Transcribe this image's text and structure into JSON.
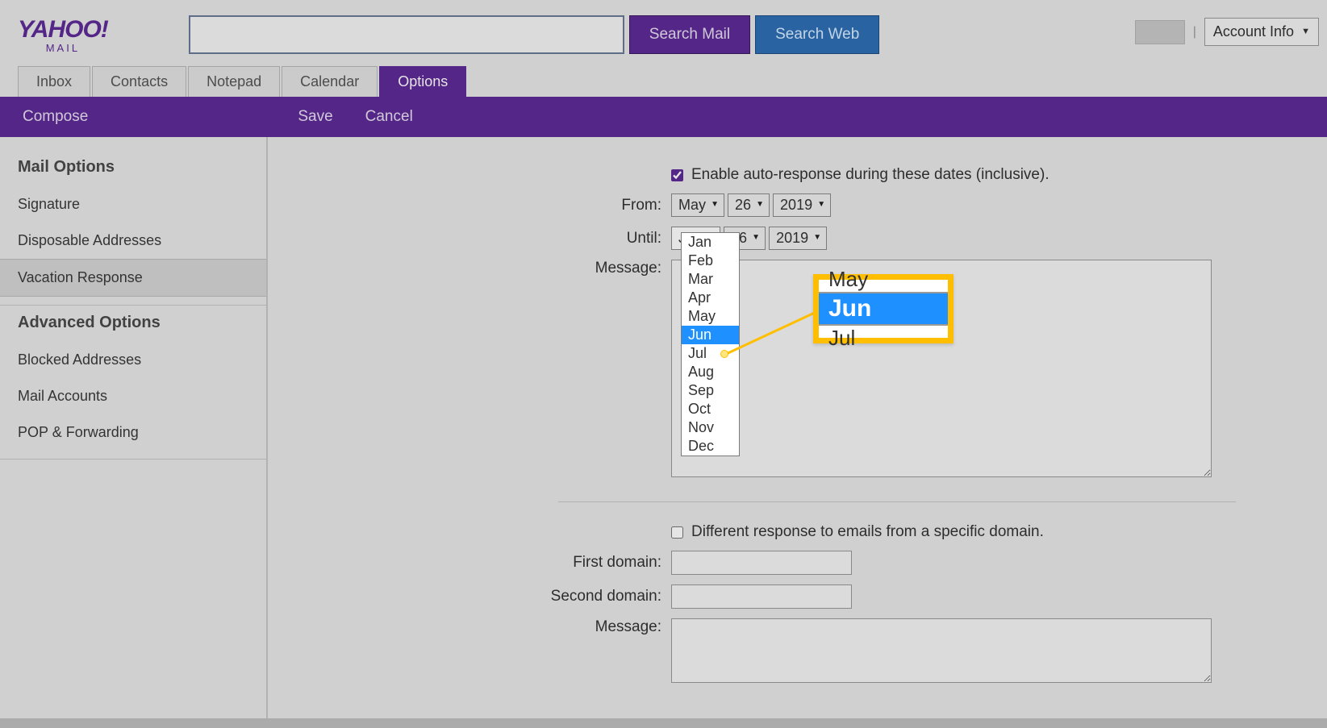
{
  "logo": {
    "main": "YAHOO!",
    "sub": "MAIL"
  },
  "search": {
    "value": "",
    "mail_button": "Search Mail",
    "web_button": "Search Web"
  },
  "account_menu": {
    "label": "Account Info"
  },
  "tabs": {
    "inbox": "Inbox",
    "contacts": "Contacts",
    "notepad": "Notepad",
    "calendar": "Calendar",
    "options": "Options",
    "active": "options"
  },
  "actions": {
    "compose": "Compose",
    "save": "Save",
    "cancel": "Cancel"
  },
  "sidebar": {
    "heading_mail": "Mail Options",
    "items_mail": [
      "Signature",
      "Disposable Addresses",
      "Vacation Response"
    ],
    "selected_mail": "Vacation Response",
    "heading_adv": "Advanced Options",
    "items_adv": [
      "Blocked Addresses",
      "Mail Accounts",
      "POP & Forwarding"
    ]
  },
  "form": {
    "enable_label": "Enable auto-response during these dates (inclusive).",
    "enable_checked": true,
    "from_label": "From:",
    "from": {
      "month": "May",
      "day": "26",
      "year": "2019"
    },
    "until_label": "Until:",
    "until": {
      "month": "Jan",
      "day": "26",
      "year": "2019"
    },
    "message_label": "Message:",
    "diff_label": "Different response to emails from a specific domain.",
    "diff_checked": false,
    "first_domain_label": "First domain:",
    "second_domain_label": "Second domain:",
    "message2_label": "Message:",
    "months": [
      "Jan",
      "Feb",
      "Mar",
      "Apr",
      "May",
      "Jun",
      "Jul",
      "Aug",
      "Sep",
      "Oct",
      "Nov",
      "Dec"
    ],
    "month_highlight": "Jun"
  },
  "callout": {
    "prev": "May",
    "selected": "Jun",
    "next": "Jul"
  }
}
